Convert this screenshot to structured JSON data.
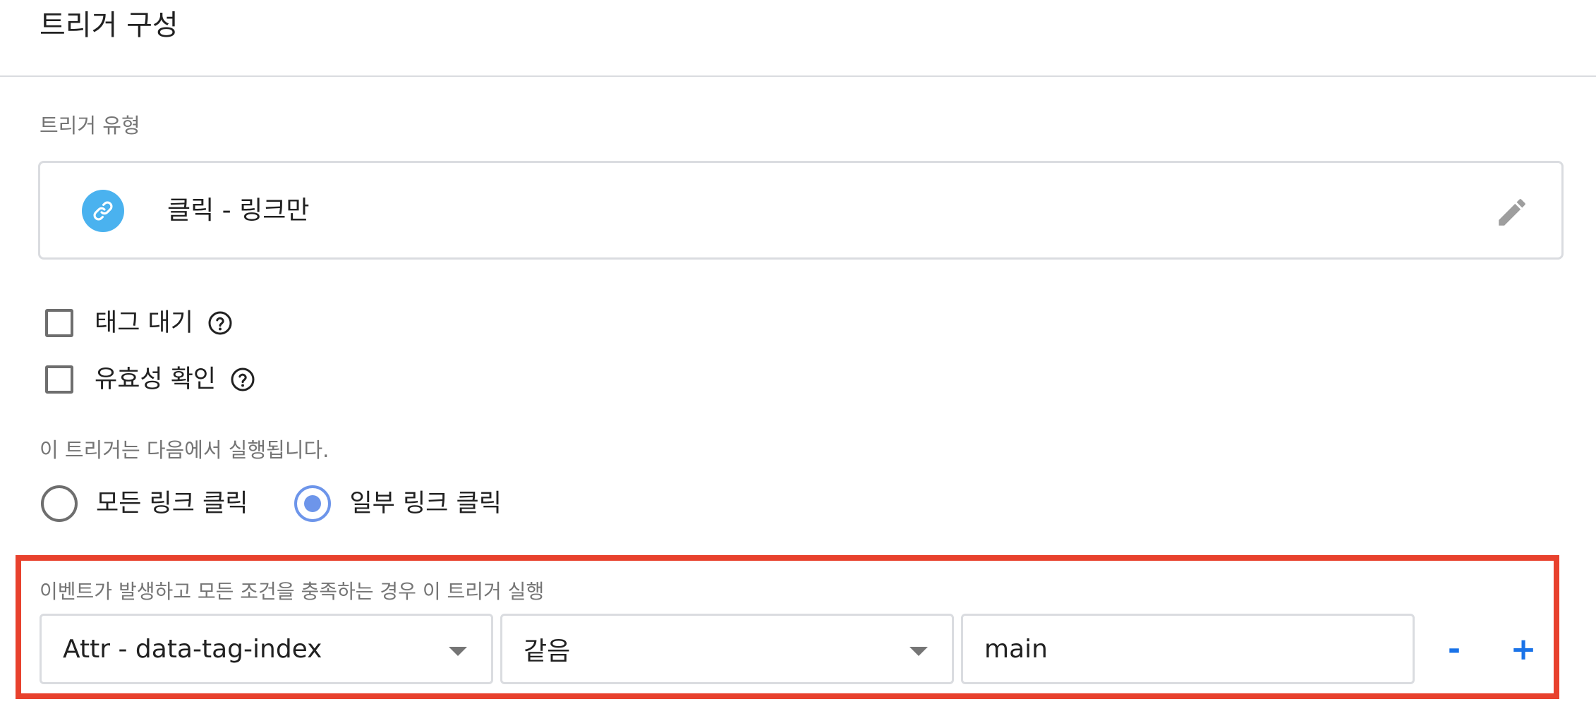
{
  "header": {
    "title": "트리거 구성"
  },
  "trigger_type": {
    "label": "트리거 유형",
    "name": "클릭 - 링크만",
    "icon": "link-icon",
    "icon_color": "#4ab2ef"
  },
  "options": {
    "wait_for_tags": "태그 대기",
    "check_validation": "유효성 확인"
  },
  "fires_on": {
    "label": "이 트리거는 다음에서 실행됩니다.",
    "all_clicks": "모든 링크 클릭",
    "some_clicks": "일부 링크 클릭",
    "selected": "some_clicks"
  },
  "condition": {
    "label": "이벤트가 발생하고 모든 조건을 충족하는 경우 이 트리거 실행",
    "variable": "Attr - data-tag-index",
    "operator": "같음",
    "value": "main",
    "remove_label": "-",
    "add_label": "+"
  },
  "colors": {
    "accent": "#1a73e8",
    "radio_selected": "#6d95ea",
    "highlight": "#e8412d"
  }
}
